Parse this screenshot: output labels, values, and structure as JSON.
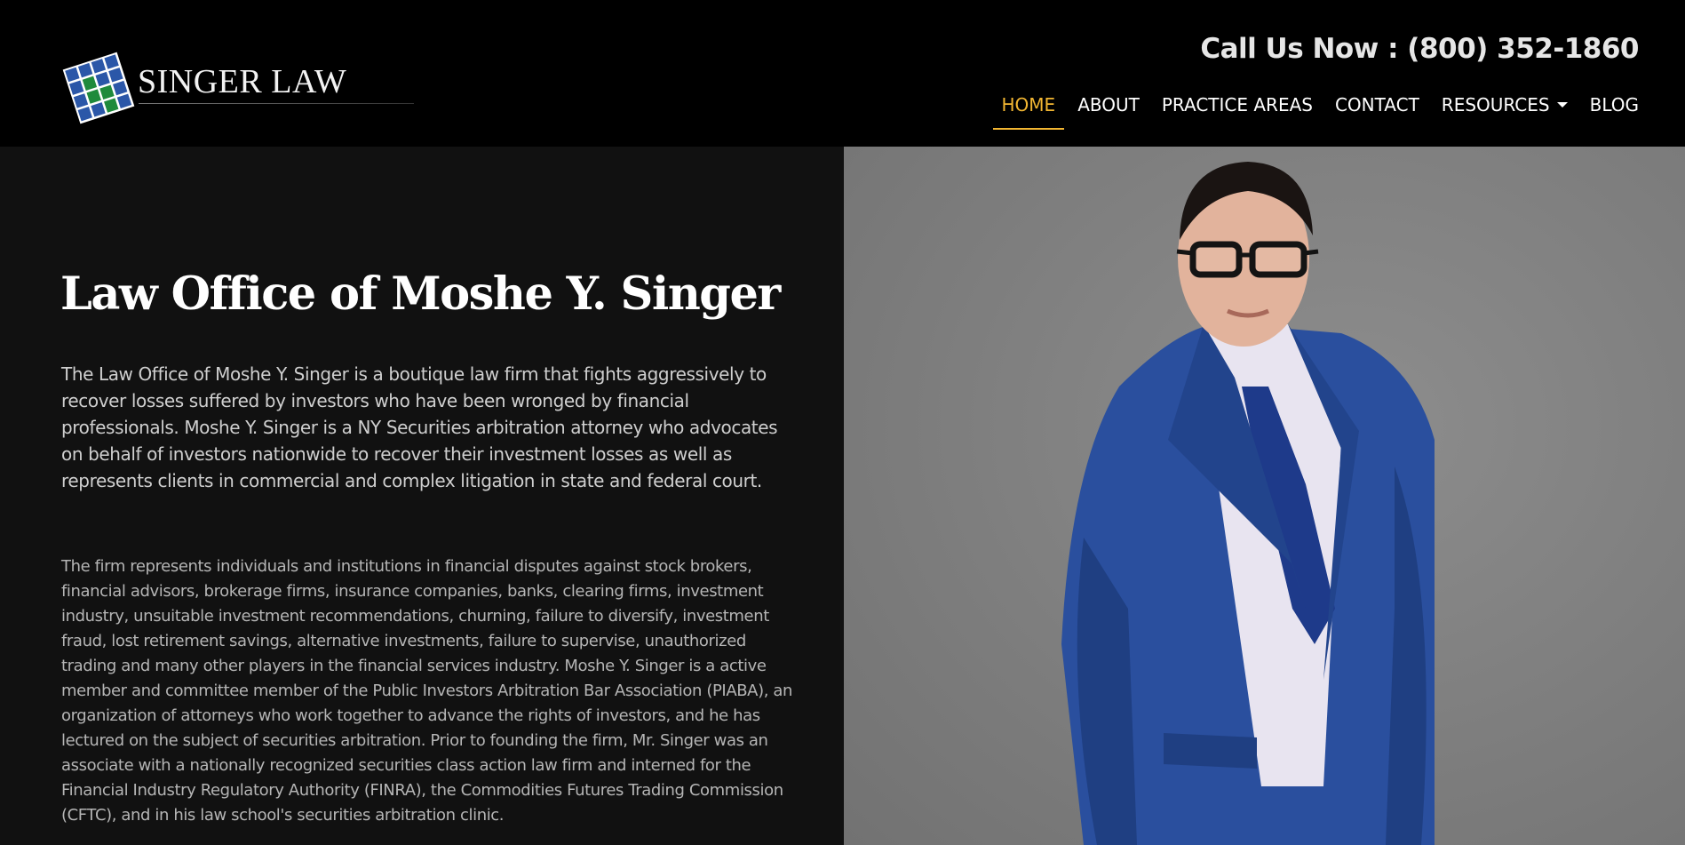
{
  "header": {
    "logo_text": "SINGER LAW",
    "call": "Call Us Now : (800) 352-1860",
    "nav": [
      {
        "label": "HOME"
      },
      {
        "label": "ABOUT"
      },
      {
        "label": "PRACTICE AREAS"
      },
      {
        "label": "CONTACT"
      },
      {
        "label": "RESOURCES"
      },
      {
        "label": "BLOG"
      }
    ]
  },
  "main": {
    "title": "Law Office of Moshe Y. Singer",
    "paragraph1": "The Law Office of Moshe Y. Singer is a boutique law firm that fights aggressively to recover losses suffered by investors who have been wronged by financial professionals. Moshe Y. Singer is a NY Securities arbitration attorney who advocates on behalf of investors nationwide to recover their investment losses as well as represents clients in commercial and complex litigation in state and federal court.",
    "paragraph2": "The firm represents individuals and institutions in financial disputes against stock brokers, financial advisors, brokerage firms, insurance companies, banks, clearing firms, investment industry, unsuitable investment recommendations, churning, failure to diversify, investment fraud, lost retirement savings, alternative investments, failure to supervise, unauthorized trading and many other players in the financial services industry. Moshe Y. Singer is a active member and committee member of the Public Investors Arbitration Bar Association (PIABA), an organization of attorneys who work together to advance the rights of investors, and he has lectured on the subject of securities arbitration. Prior to founding the firm, Mr. Singer was an associate with a nationally recognized securities class action law firm and interned for the Financial Industry Regulatory Authority (FINRA), the Commodities Futures Trading Commission (CFTC), and in his law school's securities arbitration clinic."
  },
  "colors": {
    "accent": "#f2b632",
    "header_bg": "#000000",
    "content_bg": "#111111",
    "suit": "#2a4f9e"
  }
}
